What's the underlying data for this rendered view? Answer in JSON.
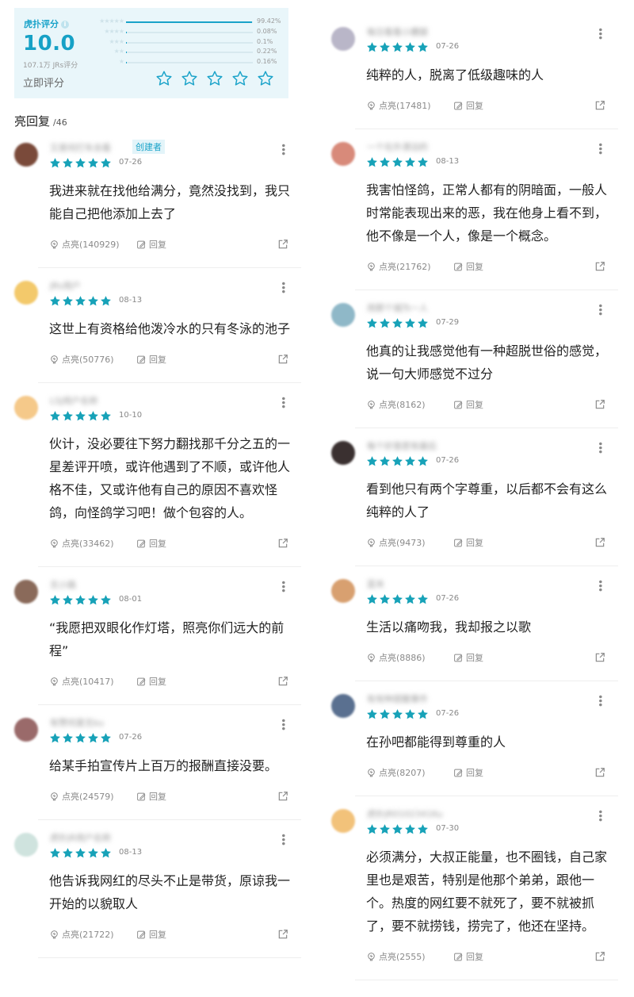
{
  "rating": {
    "brand": "虎扑评分",
    "score": "10.0",
    "count_text": "107.1万 JRs评分",
    "rate_now": "立即评分",
    "distribution": [
      {
        "stars": "★★★★★",
        "percent_text": "99.42%",
        "fraction": 0.9942
      },
      {
        "stars": "★★★★",
        "percent_text": "0.08%",
        "fraction": 0.0008
      },
      {
        "stars": "★★★",
        "percent_text": "0.1%",
        "fraction": 0.001
      },
      {
        "stars": "★★",
        "percent_text": "0.22%",
        "fraction": 0.0022
      },
      {
        "stars": "★",
        "percent_text": "0.16%",
        "fraction": 0.0016
      }
    ]
  },
  "section": {
    "title": "亮回复",
    "count": "/46"
  },
  "labels": {
    "creator": "创建者",
    "reply": "回复",
    "light_prefix": "点亮"
  },
  "colors": {
    "accent": "#1aa3c9",
    "star": "#17a2b8"
  },
  "left_comments": [
    {
      "user": "又是何打车去看",
      "creator": true,
      "date": "07-26",
      "text": "我进来就在找他给满分，竟然没找到，我只能自己把他添加上去了",
      "likes": "点亮(140929)",
      "avatar": "#7a4a3a"
    },
    {
      "user": "JRs用户",
      "creator": false,
      "date": "08-13",
      "text": "这世上有资格给他泼冷水的只有冬泳的池子",
      "likes": "点亮(50776)",
      "avatar": "#f3c96b"
    },
    {
      "user": "LSJ用户名称",
      "creator": false,
      "date": "10-10",
      "text": "伙计，没必要往下努力翻找那千分之五的一星差评开喷，或许他遇到了不顺，或许他人格不佳，又或许他有自己的原因不喜欢怪鸽，向怪鸽学习吧！做个包容的人。",
      "likes": "点亮(33462)",
      "avatar": "#f5c98a"
    },
    {
      "user": "无小路",
      "creator": false,
      "date": "08-01",
      "text": "“我愿把双眼化作灯塔，照亮你们远大的前程”",
      "likes": "点亮(10417)",
      "avatar": "#8a6a5a"
    },
    {
      "user": "有赞何夏无ku",
      "creator": false,
      "date": "07-26",
      "text": "给某手拍宣传片上百万的报酬直接没要。",
      "likes": "点亮(24579)",
      "avatar": "#9a6a6a"
    },
    {
      "user": "虎扑JR用户名称",
      "creator": false,
      "date": "08-13",
      "text": "他告诉我网红的尽头不止是带货，原谅我一开始的以貌取人",
      "likes": "点亮(21722)",
      "avatar": "#cfe3de"
    }
  ],
  "right_comments": [
    {
      "user": "每日看看小腰腿",
      "date": "07-26",
      "text": "纯粹的人，脱离了低级趣味的人",
      "likes": "点亮(17481)",
      "avatar": "#b9b6c8"
    },
    {
      "user": "一个在外漂泊的",
      "date": "08-13",
      "text": "我害怕怪鸽，正常人都有的阴暗面，一般人时常能表现出来的恶，我在他身上看不到，他不像是一个人，像是一个概念。",
      "likes": "点亮(21762)",
      "avatar": "#d88a7a"
    },
    {
      "user": "用那个城为一人",
      "date": "07-29",
      "text": "他真的让我感觉他有一种超脱世俗的感觉，说一句大师感觉不过分",
      "likes": "点亮(8162)",
      "avatar": "#8fb8c8"
    },
    {
      "user": "每个好意愿有最后",
      "date": "07-26",
      "text": "看到他只有两个字尊重，以后都不会有这么纯粹的人了",
      "likes": "点亮(9473)",
      "avatar": "#3a3030"
    },
    {
      "user": "蓝末",
      "date": "07-26",
      "text": "生活以痛吻我，我却报之以歌",
      "likes": "点亮(8886)",
      "avatar": "#d8a070"
    },
    {
      "user": "有有种提醒事件",
      "date": "07-26",
      "text": "在孙吧都能得到尊重的人",
      "likes": "点亮(8207)",
      "avatar": "#5a7090"
    },
    {
      "user": "虎扑JR0102341Ku",
      "date": "07-30",
      "text": "必须满分，大叔正能量，也不圈钱，自己家里也是艰苦，特别是他那个弟弟，跟他一个。热度的网红要不就死了，要不就被抓了，要不就捞钱，捞完了，他还在坚持。",
      "likes": "点亮(2555)",
      "avatar": "#f2c27a"
    }
  ]
}
